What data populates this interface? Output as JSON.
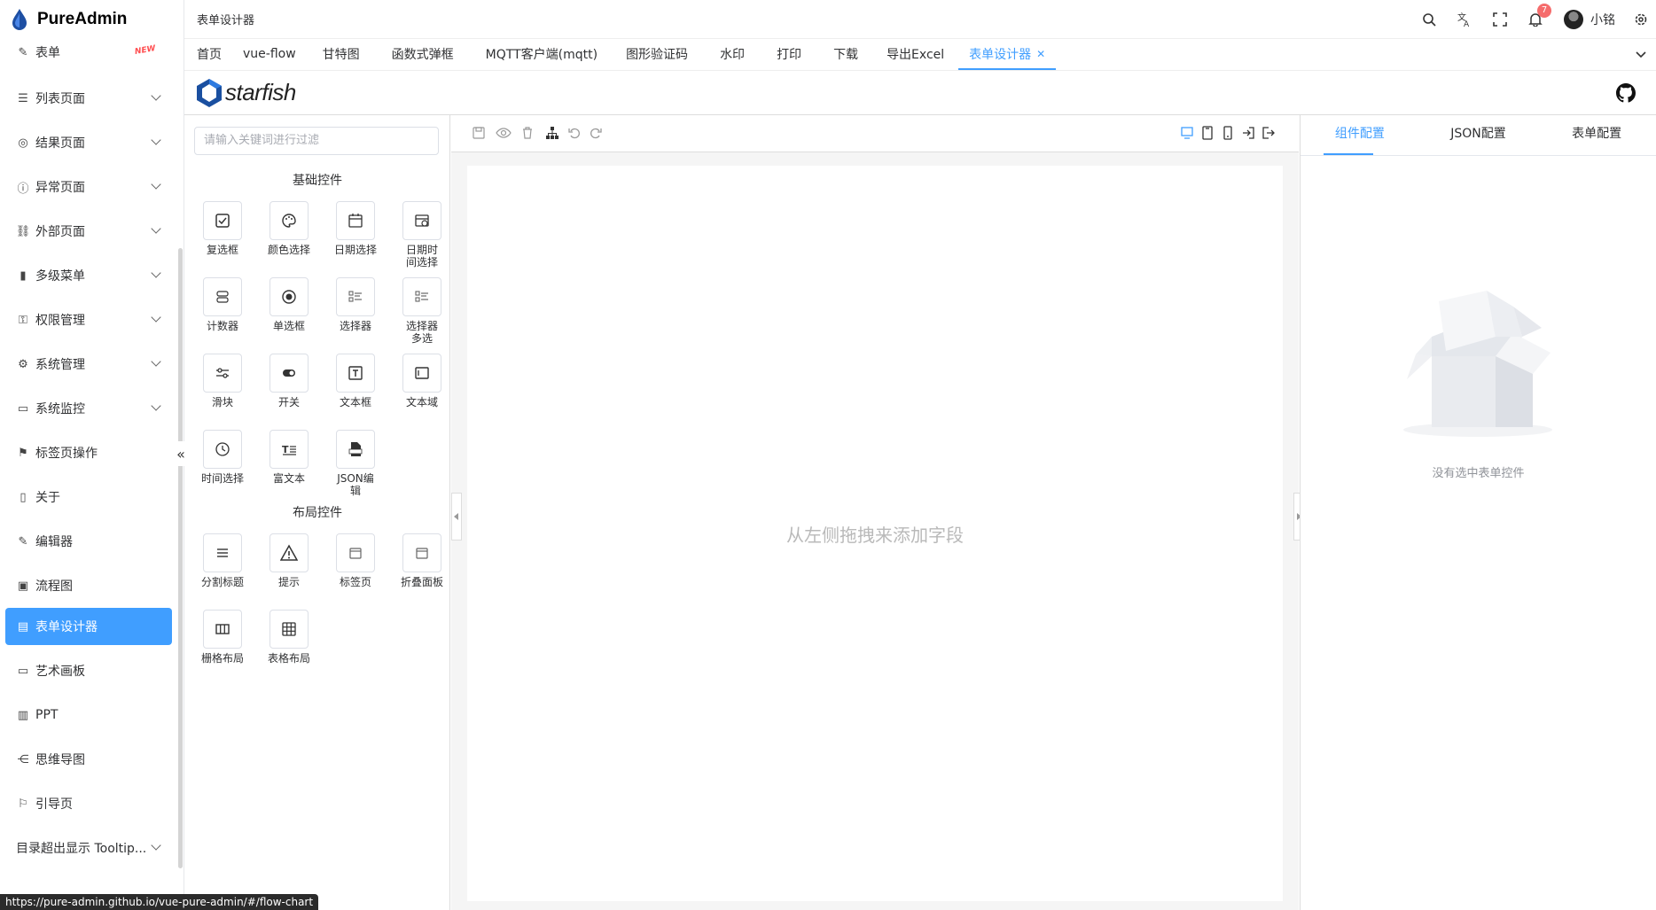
{
  "app": {
    "name": "PureAdmin"
  },
  "sidebar": {
    "items": [
      {
        "label": "表单",
        "icon": "edit-icon",
        "badge": "NEW"
      },
      {
        "label": "列表页面",
        "icon": "list-icon"
      },
      {
        "label": "结果页面",
        "icon": "check-circle-icon"
      },
      {
        "label": "异常页面",
        "icon": "info-circle-icon"
      },
      {
        "label": "外部页面",
        "icon": "link-icon"
      },
      {
        "label": "多级菜单",
        "icon": "bar-chart-icon"
      },
      {
        "label": "权限管理",
        "icon": "key-icon"
      },
      {
        "label": "系统管理",
        "icon": "settings-icon"
      },
      {
        "label": "系统监控",
        "icon": "monitor-icon"
      },
      {
        "label": "标签页操作",
        "icon": "bookmark-icon"
      },
      {
        "label": "关于",
        "icon": "about-icon"
      },
      {
        "label": "编辑器",
        "icon": "editor-icon"
      },
      {
        "label": "流程图",
        "icon": "flowchart-icon"
      },
      {
        "label": "表单设计器",
        "icon": "form-designer-icon"
      },
      {
        "label": "艺术画板",
        "icon": "board-icon"
      },
      {
        "label": "PPT",
        "icon": "ppt-icon"
      },
      {
        "label": "思维导图",
        "icon": "mindmap-icon"
      },
      {
        "label": "引导页",
        "icon": "guide-icon"
      },
      {
        "label": "目录超出显示 Tooltip...",
        "icon": ""
      }
    ],
    "status_url": "https://pure-admin.github.io/vue-pure-admin/#/flow-chart"
  },
  "header": {
    "breadcrumb": "表单设计器",
    "notification_count": "7",
    "username": "小铭"
  },
  "tabs": [
    "首页",
    "vue-flow",
    "甘特图",
    "函数式弹框",
    "MQTT客户端(mqtt)",
    "图形验证码",
    "水印",
    "打印",
    "下载",
    "导出Excel",
    "表单设计器"
  ],
  "designer": {
    "brand": "starfish",
    "search_placeholder": "请输入关键词进行过滤",
    "basic_title": "基础控件",
    "layout_title": "布局控件",
    "basic_widgets": [
      {
        "label": "复选框",
        "icon": "checkbox-icon"
      },
      {
        "label": "颜色选择",
        "icon": "palette-icon"
      },
      {
        "label": "日期选择",
        "icon": "calendar-icon"
      },
      {
        "label": "日期时间选择",
        "icon": "datetime-icon"
      },
      {
        "label": "计数器",
        "icon": "counter-icon"
      },
      {
        "label": "单选框",
        "icon": "radio-icon"
      },
      {
        "label": "选择器",
        "icon": "select-icon"
      },
      {
        "label": "选择器多选",
        "icon": "multi-select-icon"
      },
      {
        "label": "滑块",
        "icon": "slider-icon"
      },
      {
        "label": "开关",
        "icon": "switch-icon"
      },
      {
        "label": "文本框",
        "icon": "textbox-icon"
      },
      {
        "label": "文本域",
        "icon": "textarea-icon"
      },
      {
        "label": "时间选择",
        "icon": "clock-icon"
      },
      {
        "label": "富文本",
        "icon": "richtext-icon"
      },
      {
        "label": "JSON编辑",
        "icon": "json-icon"
      }
    ],
    "layout_widgets": [
      {
        "label": "分割标题",
        "icon": "divider-icon"
      },
      {
        "label": "提示",
        "icon": "alert-icon"
      },
      {
        "label": "标签页",
        "icon": "tabs-icon"
      },
      {
        "label": "折叠面板",
        "icon": "collapse-icon"
      },
      {
        "label": "栅格布局",
        "icon": "grid-icon"
      },
      {
        "label": "表格布局",
        "icon": "table-icon"
      }
    ],
    "canvas_hint": "从左侧拖拽来添加字段",
    "right_tabs": [
      "组件配置",
      "JSON配置",
      "表单配置"
    ],
    "empty_text": "没有选中表单控件"
  },
  "colors": {
    "accent": "#409eff",
    "badge": "#f56c6c"
  }
}
